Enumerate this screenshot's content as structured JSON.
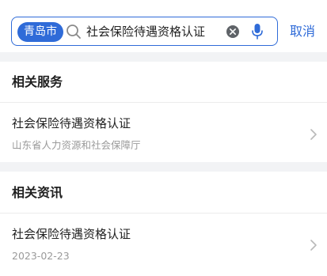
{
  "search": {
    "city": "青岛市",
    "query": "社会保险待遇资格认证",
    "cancel_label": "取消"
  },
  "sections": [
    {
      "title": "相关服务",
      "items": [
        {
          "title": "社会保险待遇资格认证",
          "subtitle": "山东省人力资源和社会保障厅"
        }
      ]
    },
    {
      "title": "相关资讯",
      "items": [
        {
          "title": "社会保险待遇资格认证",
          "subtitle": "2023-02-23"
        }
      ]
    }
  ],
  "colors": {
    "accent": "#2f6bd8",
    "background": "#f2f3f5",
    "secondary_text": "#9a9a9a"
  },
  "icons": [
    "search-icon",
    "clear-icon",
    "microphone-icon",
    "chevron-right-icon"
  ]
}
